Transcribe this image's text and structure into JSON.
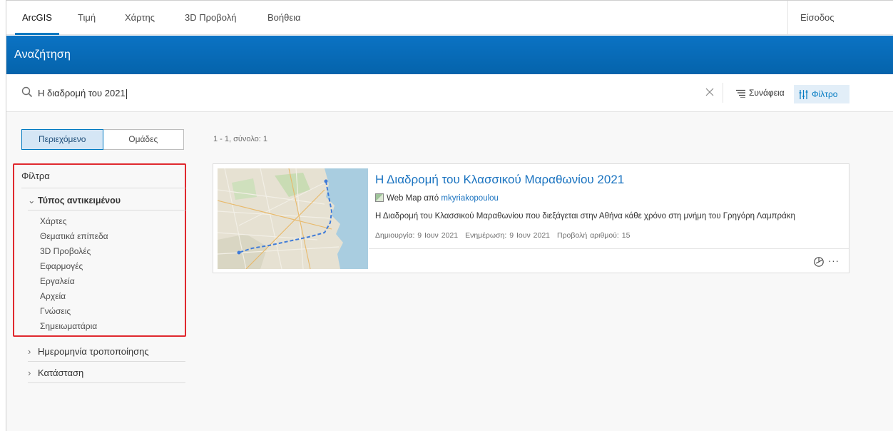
{
  "nav": {
    "tabs": [
      {
        "label": "ArcGIS"
      },
      {
        "label": "Τιμή"
      },
      {
        "label": "Χάρτης"
      },
      {
        "label": "3D Προβολή"
      },
      {
        "label": "Βοήθεια"
      }
    ],
    "signin": "Είσοδος"
  },
  "banner": {
    "title": "Αναζήτηση"
  },
  "search": {
    "query": "Η διαδρομή του 2021",
    "sort_label": "Συνάφεια",
    "filter_label": "Φίλτρο"
  },
  "segments": {
    "content": "Περιεχόμενο",
    "groups": "Ομάδες"
  },
  "filters": {
    "heading": "Φίλτρα",
    "item_type": {
      "label": "Τύπος αντικειμένου",
      "items": [
        "Χάρτες",
        "Θεματικά επίπεδα",
        "3D Προβολές",
        "Εφαρμογές",
        "Εργαλεία",
        "Αρχεία",
        "Γνώσεις",
        "Σημειωματάρια"
      ]
    },
    "modified": "Ημερομηνία τροποποίησης",
    "status": "Κατάσταση"
  },
  "results": {
    "count": "1 - 1, σύνολο: 1",
    "items": [
      {
        "title": "Η Διαδρομή του Κλασσικού Μαραθωνίου 2021",
        "type": "Web Map από",
        "owner": "mkyriakopoulou",
        "description": "Η Διαδρομή του Κλασσικού Μαραθωνίου που διεξάγεται στην Αθήνα κάθε χρόνο στη μνήμη του Γρηγόρη Λαμπράκη",
        "created": "Δημιουργία: 9 Ιουν 2021",
        "updated": "Ενημέρωση: 9 Ιουν 2021",
        "views": "Προβολή αριθμού: 15",
        "more": "···"
      }
    ]
  },
  "colors": {
    "accent": "#0079c1",
    "highlight": "#e0292f"
  }
}
